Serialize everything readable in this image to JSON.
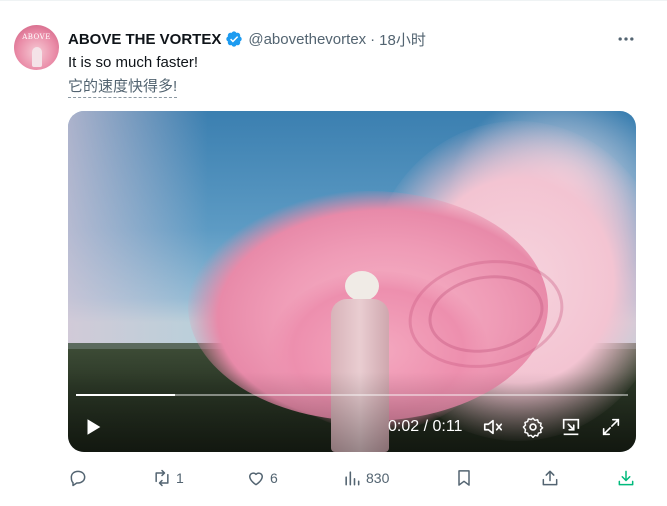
{
  "author": {
    "display_name": "ABOVE THE VORTEX",
    "handle": "@abovethevortex",
    "separator": "·",
    "time": "18小时",
    "avatar_logo": "ABOVE",
    "verified": true,
    "verified_color": "#1d9bf0"
  },
  "tweet": {
    "text": "It is so much faster!",
    "translation": "它的速度快得多!"
  },
  "video": {
    "timecode": "0:02 / 0:11",
    "progress": 0.18,
    "controls": [
      "play-icon",
      "mute-icon",
      "settings-icon",
      "pip-icon",
      "fullscreen-icon"
    ]
  },
  "actions": {
    "replies": "",
    "retweets": "1",
    "likes": "6",
    "views": "830"
  },
  "colors": {
    "secondary_text": "#536471",
    "download_accent": "#00ba7c",
    "brand_blue": "#1d9bf0"
  }
}
